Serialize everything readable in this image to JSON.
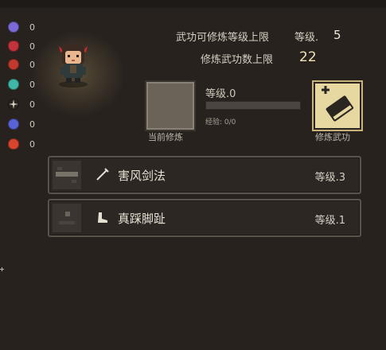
{
  "stats": [
    {
      "icon": "skull-icon",
      "color": "#7c6ad8",
      "value": "0"
    },
    {
      "icon": "broken-heart-icon",
      "color": "#c2333b",
      "value": "0"
    },
    {
      "icon": "bug-icon",
      "color": "#c23a2e",
      "value": "0"
    },
    {
      "icon": "poison-skull-icon",
      "color": "#3fb7a8",
      "value": "0"
    },
    {
      "icon": "sparkle-icon",
      "color": "#d9d0c0",
      "value": "0"
    },
    {
      "icon": "ghost-icon",
      "color": "#5a63d6",
      "value": "0"
    },
    {
      "icon": "flame-icon",
      "color": "#d8452c",
      "value": "0"
    }
  ],
  "limits": {
    "max_level_label": "武功可修炼等级上限",
    "level_prefix": "等级.",
    "max_level_value": "5",
    "max_count_label": "修炼武功数上限",
    "max_count_value": "22"
  },
  "current": {
    "caption": "当前修炼",
    "level_text": "等级.0",
    "xp_text": "经验: 0/0",
    "xp_fraction": 0
  },
  "cultivate": {
    "caption": "修炼武功",
    "icon": "book-plus-icon"
  },
  "skills": [
    {
      "icon": "sword-icon",
      "name": "害风剑法",
      "level": "等级.3"
    },
    {
      "icon": "boot-icon",
      "name": "真踩脚趾",
      "level": "等级.1"
    }
  ]
}
